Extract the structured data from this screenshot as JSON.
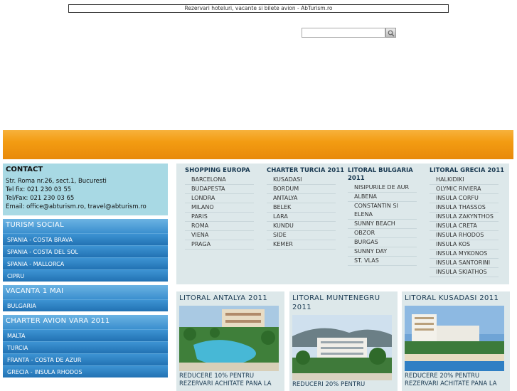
{
  "page": {
    "title": "Rezervari hoteluri, vacante si bilete avion - AbTurism.ro"
  },
  "search": {
    "placeholder": ""
  },
  "contact": {
    "heading": "CONTACT",
    "lines": [
      "Str. Roma nr.26, sect.1, Bucuresti",
      "Tel fix: 021 230 03 55",
      "Tel/Fax: 021 230 03 65",
      "Email: office@abturism.ro, travel@abturism.ro"
    ]
  },
  "sidebar": {
    "boxes": [
      {
        "title": "TURISM SOCIAL",
        "items": [
          "SPANIA - COSTA BRAVA",
          "SPANIA - COSTA DEL SOL",
          "SPANIA - MALLORCA",
          "CIPRU"
        ]
      },
      {
        "title": "VACANTA 1 MAI",
        "items": [
          "BULGARIA"
        ]
      },
      {
        "title": "CHARTER AVION VARA 2011",
        "items": [
          "MALTA",
          "TURCIA",
          "FRANTA - COSTA DE AZUR",
          "GRECIA - INSULA RHODOS"
        ]
      }
    ]
  },
  "menu": {
    "columns": [
      {
        "heading": "SHOPPING EUROPA",
        "items": [
          "BARCELONA",
          "BUDAPESTA",
          "LONDRA",
          "MILANO",
          "PARIS",
          "ROMA",
          "VIENA",
          "PRAGA"
        ]
      },
      {
        "heading": "CHARTER TURCIA 2011",
        "items": [
          "KUSADASI",
          "BORDUM",
          "ANTALYA",
          "BELEK",
          "LARA",
          "KUNDU",
          "SIDE",
          "KEMER"
        ]
      },
      {
        "heading": "LITORAL BULGARIA 2011",
        "items": [
          "NISIPURILE DE AUR",
          "ALBENA",
          "CONSTANTIN SI ELENA",
          "SUNNY BEACH",
          "OBZOR",
          "BURGAS",
          "SUNNY DAY",
          "ST. VLAS"
        ]
      },
      {
        "heading": "LITORAL GRECIA 2011",
        "items": [
          "HALKIDIKI",
          "OLYMIC RIVIERA",
          "INSULA CORFU",
          "INSULA THASSOS",
          "INSULA ZAKYNTHOS",
          "INSULA CRETA",
          "INSULA RHODOS",
          "INSULA KOS",
          "INSULA MYKONOS",
          "INSULA SANTORINI",
          "INSULA SKIATHOS"
        ]
      }
    ]
  },
  "cards": [
    {
      "title": "LITORAL ANTALYA 2011",
      "desc": "REDUCERE 10% PENTRU REZERVARI ACHITATE PANA LA"
    },
    {
      "title": "LITORAL MUNTENEGRU 2011",
      "desc": "REDUCERI 20% PENTRU"
    },
    {
      "title": "LITORAL KUSADASI 2011",
      "desc": "REDUCERE 20% PENTRU REZERVARI ACHITATE PANA LA"
    }
  ],
  "colors": {
    "orange_banner": "#f39c12",
    "contact_bg": "#a8d9e4",
    "box_blue": "#2b7fbd",
    "panel_bg": "#dde8ea"
  }
}
